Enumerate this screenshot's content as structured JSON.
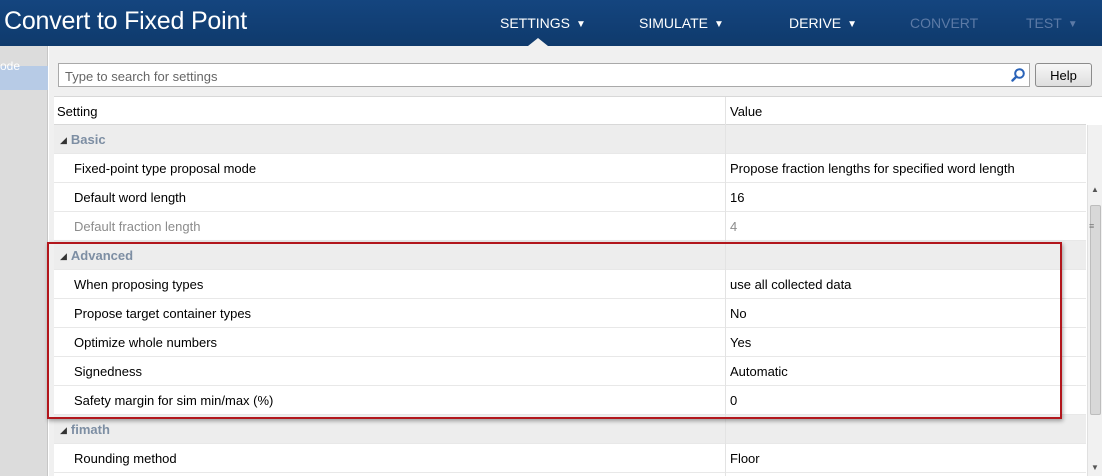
{
  "app": {
    "title": "Convert to Fixed Point"
  },
  "nav": {
    "items": [
      {
        "label": "SETTINGS",
        "caret": "▼"
      },
      {
        "label": "SIMULATE",
        "caret": "▼"
      },
      {
        "label": "DERIVE",
        "caret": "▼"
      },
      {
        "label": "CONVERT",
        "caret": ""
      },
      {
        "label": "TEST",
        "caret": "▼"
      }
    ]
  },
  "left_panel": {
    "label": "ode"
  },
  "search": {
    "placeholder": "Type to search for settings",
    "icon": "search-icon"
  },
  "help_button": {
    "label": "Help"
  },
  "table": {
    "columns": [
      "Setting",
      "Value"
    ],
    "groups": [
      {
        "name": "Basic",
        "rows": [
          {
            "setting": "Fixed-point type proposal mode",
            "value": "Propose fraction lengths for specified word length",
            "enabled": true
          },
          {
            "setting": "Default word length",
            "value": "16",
            "enabled": true
          },
          {
            "setting": "Default fraction length",
            "value": "4",
            "enabled": false
          }
        ]
      },
      {
        "name": "Advanced",
        "rows": [
          {
            "setting": "When proposing types",
            "value": "use all collected data",
            "enabled": true
          },
          {
            "setting": "Propose target container types",
            "value": "No",
            "enabled": true
          },
          {
            "setting": "Optimize whole numbers",
            "value": "Yes",
            "enabled": true
          },
          {
            "setting": "Signedness",
            "value": "Automatic",
            "enabled": true
          },
          {
            "setting": "Safety margin for sim min/max (%)",
            "value": "0",
            "enabled": true
          }
        ]
      },
      {
        "name": "fimath",
        "rows": [
          {
            "setting": "Rounding method",
            "value": "Floor",
            "enabled": true
          }
        ]
      }
    ]
  },
  "colors": {
    "titlebar": "#14457f",
    "highlight_border": "#b2161c",
    "group_label": "#7d8ea3"
  }
}
